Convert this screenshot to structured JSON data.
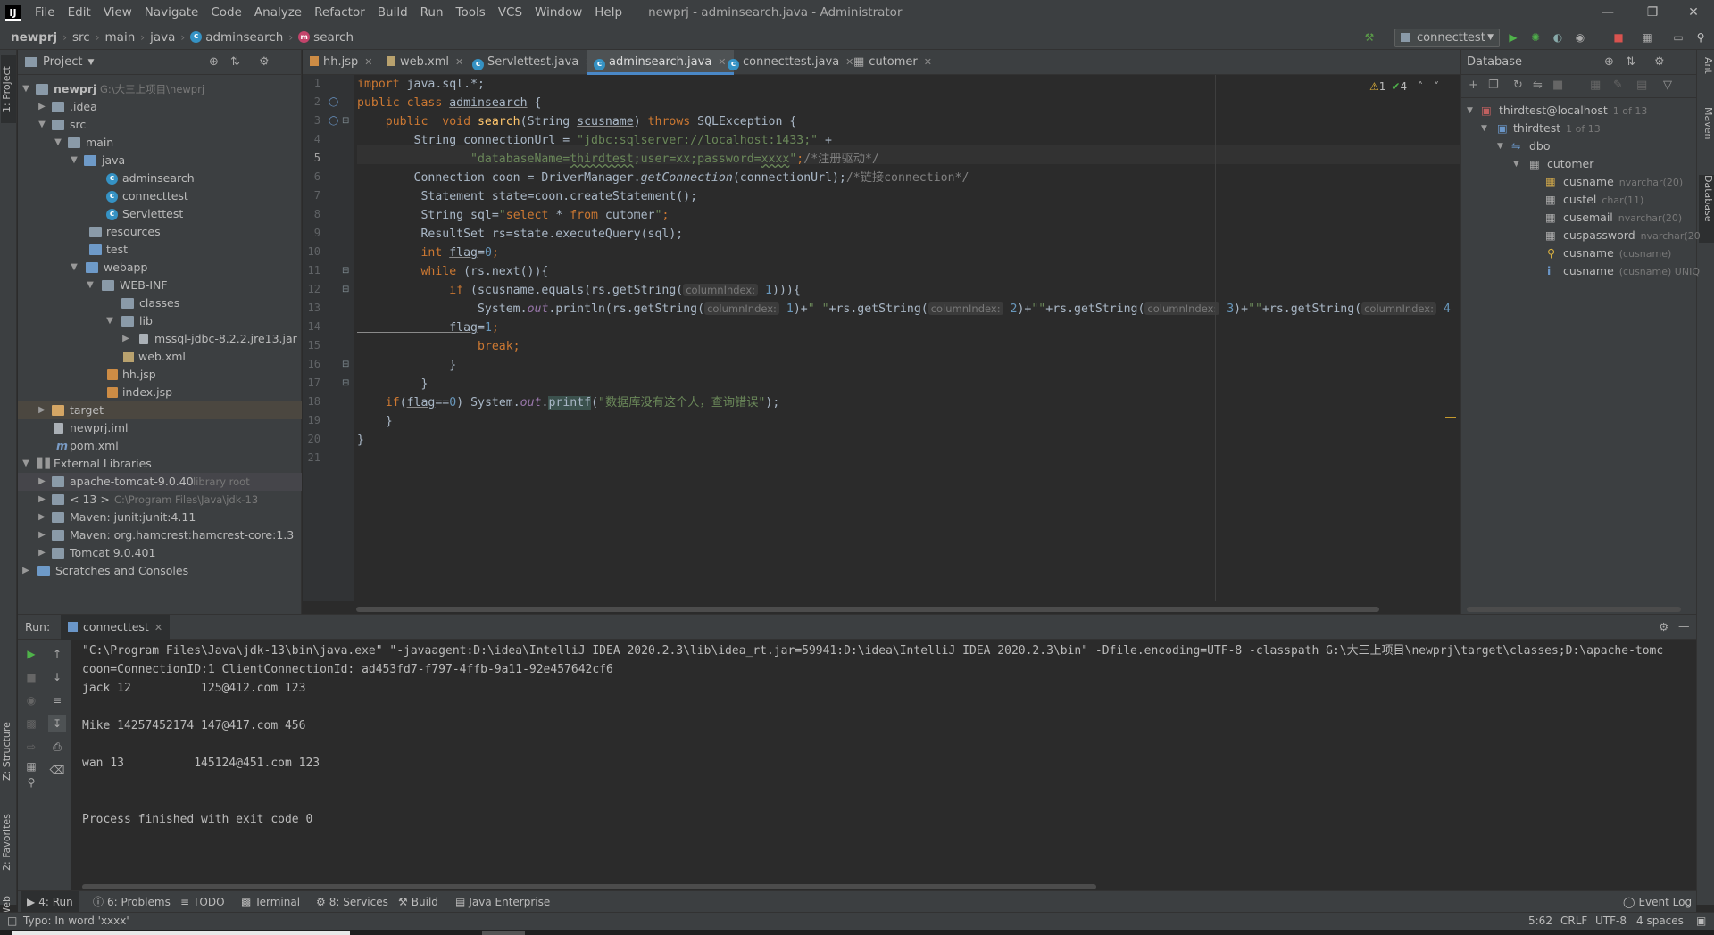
{
  "window": {
    "title": "newprj - adminsearch.java - Administrator",
    "logo": "IJ",
    "menus": [
      "File",
      "Edit",
      "View",
      "Navigate",
      "Code",
      "Analyze",
      "Refactor",
      "Build",
      "Run",
      "Tools",
      "VCS",
      "Window",
      "Help"
    ]
  },
  "breadcrumb": [
    "newprj",
    "src",
    "main",
    "java",
    "adminsearch",
    "search"
  ],
  "toolbar": {
    "run_config": "connecttest"
  },
  "left_stripe": {
    "project": "1: Project",
    "structure": "Z: Structure",
    "favorites": "2: Favorites",
    "web": "Web"
  },
  "right_stripe": {
    "ant": "Ant",
    "maven": "Maven",
    "database": "Database"
  },
  "project_panel": {
    "title": "Project",
    "tree": [
      {
        "label": "newprj",
        "extra": "G:\\大三上项目\\newprj"
      },
      {
        "label": ".idea"
      },
      {
        "label": "src"
      },
      {
        "label": "main"
      },
      {
        "label": "java"
      },
      {
        "label": "adminsearch"
      },
      {
        "label": "connecttest"
      },
      {
        "label": "Servlettest"
      },
      {
        "label": "resources"
      },
      {
        "label": "test"
      },
      {
        "label": "webapp"
      },
      {
        "label": "WEB-INF"
      },
      {
        "label": "classes"
      },
      {
        "label": "lib"
      },
      {
        "label": "mssql-jdbc-8.2.2.jre13.jar"
      },
      {
        "label": "web.xml"
      },
      {
        "label": "hh.jsp"
      },
      {
        "label": "index.jsp"
      },
      {
        "label": "target"
      },
      {
        "label": "newprj.iml"
      },
      {
        "label": "pom.xml"
      },
      {
        "label": "External Libraries"
      },
      {
        "label": "apache-tomcat-9.0.40",
        "extra": "library root"
      },
      {
        "label": "< 13 >",
        "extra": "C:\\Program Files\\Java\\jdk-13"
      },
      {
        "label": "Maven: junit:junit:4.11"
      },
      {
        "label": "Maven: org.hamcrest:hamcrest-core:1.3"
      },
      {
        "label": "Tomcat 9.0.401"
      },
      {
        "label": "Scratches and Consoles"
      }
    ]
  },
  "editor": {
    "tabs": [
      "hh.jsp",
      "web.xml",
      "Servlettest.java",
      "adminsearch.java",
      "connecttest.java",
      "cutomer"
    ],
    "active_tab": "adminsearch.java",
    "inspections": {
      "warnings": "1",
      "weak": "4"
    },
    "line_numbers": [
      "1",
      "2",
      "3",
      "4",
      "5",
      "6",
      "7",
      "8",
      "9",
      "10",
      "11",
      "12",
      "13",
      "14",
      "15",
      "16",
      "17",
      "18",
      "19",
      "20",
      "21"
    ],
    "code": {
      "l1_kw": "import",
      "l1_rest": " java.sql.*;",
      "l2_kw": "public class ",
      "l2_name": "adminsearch",
      "l2_rest": " {",
      "l3_kw1": "    public  void ",
      "l3_fn": "search",
      "l3_p1": "(String ",
      "l3_param": "scusname",
      "l3_p2": ") ",
      "l3_kw2": "throws",
      "l3_rest": " SQLException {",
      "l4_a": "        String connectionUrl = ",
      "l4_s": "\"jdbc:sqlserver://localhost:1433;\"",
      "l4_b": " +",
      "l5_s1": "                \"databaseName=",
      "l5_db": "thirdtest",
      "l5_s2": ";user=xx;password=",
      "l5_pw": "xxxx",
      "l5_s3": "\"",
      "l5_b": ";",
      "l5_c": "/*注册驱动*/",
      "l6_a": "        Connection coon = DriverManager.",
      "l6_m": "getConnection",
      "l6_b": "(connectionUrl);",
      "l6_c": "/*链接connection*/",
      "l7": "         Statement state=coon.createStatement();",
      "l8_a": "         String sql=",
      "l8_s1": "\"",
      "l8_sq1": "select",
      "l8_sq2": " * ",
      "l8_sq3": "from",
      "l8_sq4": " cutomer",
      "l8_s2": "\"",
      "l8_b": ";",
      "l9": "         ResultSet rs=state.executeQuery(sql);",
      "l10_kw": "         int ",
      "l10_v": "flag",
      "l10_b": "=",
      "l10_n": "0",
      "l10_c": ";",
      "l11_kw": "         while",
      "l11_b": " (rs.next()){",
      "l12_kw": "             if",
      "l12_a": " (scusname.equals(rs.getString(",
      "l12_h": "columnIndex:",
      "l12_n": " 1",
      "l12_b": "))){",
      "l13_a": "                 System.",
      "l13_out": "out",
      "l13_b": ".println(rs.getString(",
      "l13_h1": "columnIndex:",
      "l13_n1": " 1",
      "l13_c": ")+",
      "l13_s1": "\" \"",
      "l13_d": "+rs.getString(",
      "l13_h2": "columnIndex:",
      "l13_n2": " 2",
      "l13_e": ")+",
      "l13_s2": "\"\"",
      "l13_f": "+rs.getString(",
      "l13_h3": "columnIndex:",
      "l13_n3": " 3",
      "l13_g": ")+",
      "l13_s3": "\"\"",
      "l13_i": "+rs.getString(",
      "l13_h4": "columnIndex:",
      "l13_n4": " 4",
      "l14_v": "             flag",
      "l14_b": "=",
      "l14_n": "1",
      "l14_c": ";",
      "l15": "                 break;",
      "l16": "             }",
      "l17": "         }",
      "l18_kw": "    if",
      "l18_a": "(",
      "l18_v": "flag",
      "l18_b": "==",
      "l18_n": "0",
      "l18_c": ") System.",
      "l18_out": "out",
      "l18_d": ".",
      "l18_fn": "printf",
      "l18_e": "(",
      "l18_s": "\"数据库没有这个人，查询错误\"",
      "l18_f": ");",
      "l19": "    }",
      "l20": "}"
    }
  },
  "database_panel": {
    "title": "Database",
    "items": [
      {
        "label": "thirdtest@localhost",
        "type": "1 of 13"
      },
      {
        "label": "thirdtest",
        "type": "1 of 13"
      },
      {
        "label": "dbo",
        "type": ""
      },
      {
        "label": "cutomer",
        "type": ""
      },
      {
        "label": "cusname",
        "type": "nvarchar(20)"
      },
      {
        "label": "custel",
        "type": "char(11)"
      },
      {
        "label": "cusemail",
        "type": "nvarchar(20)"
      },
      {
        "label": "cuspassword",
        "type": "nvarchar(20"
      },
      {
        "label": "cusname",
        "type": "(cusname)"
      },
      {
        "label": "cusname",
        "type": "(cusname) UNIQ"
      }
    ]
  },
  "run_panel": {
    "label": "Run:",
    "tab": "connecttest",
    "console": [
      "\"C:\\Program Files\\Java\\jdk-13\\bin\\java.exe\" \"-javaagent:D:\\idea\\IntelliJ IDEA 2020.2.3\\lib\\idea_rt.jar=59941:D:\\idea\\IntelliJ IDEA 2020.2.3\\bin\" -Dfile.encoding=UTF-8 -classpath G:\\大三上项目\\newprj\\target\\classes;D:\\apache-tomc",
      "coon=ConnectionID:1 ClientConnectionId: ad453fd7-f797-4ffb-9a11-92e457642cf6",
      "jack 12          125@412.com 123",
      "",
      "Mike 14257452174 147@417.com 456",
      "",
      "wan 13          145124@451.com 123",
      "",
      "",
      "Process finished with exit code 0"
    ]
  },
  "bottom_tabs": [
    "4: Run",
    "6: Problems",
    "TODO",
    "Terminal",
    "8: Services",
    "Build",
    "Java Enterprise"
  ],
  "event_log": "Event Log",
  "status": {
    "message": "Typo: In word 'xxxx'",
    "position": "5:62",
    "line_sep": "CRLF",
    "encoding": "UTF-8",
    "indent": "4 spaces"
  }
}
